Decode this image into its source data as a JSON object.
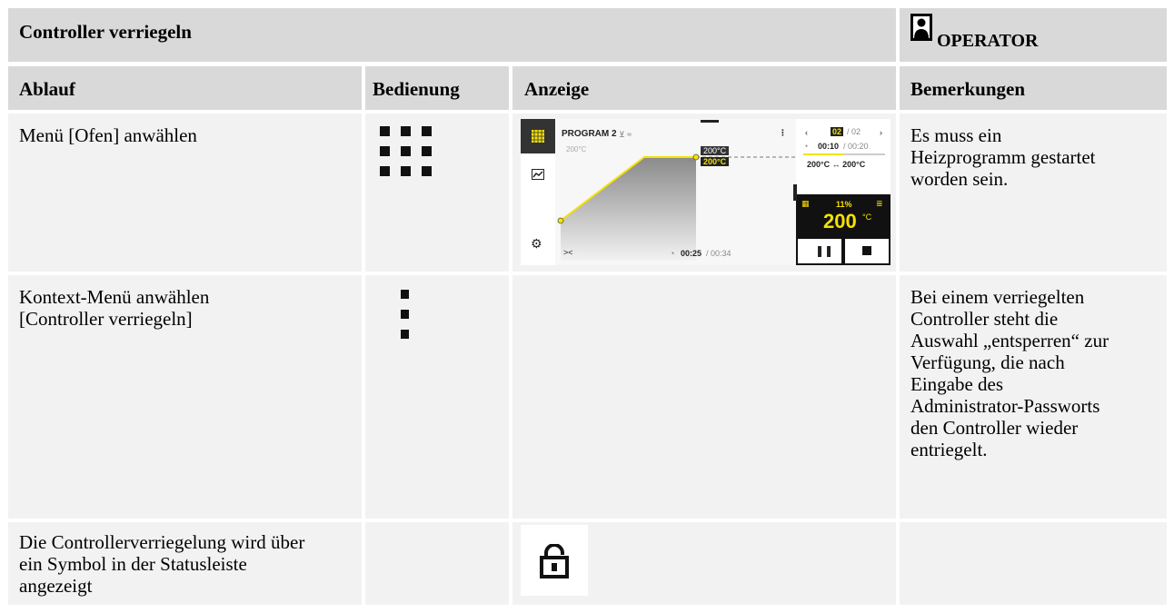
{
  "header": {
    "title": "Controller verriegeln",
    "role": "OPERATOR",
    "role_icon": "person-icon"
  },
  "columns": [
    "Ablauf",
    "Bedienung",
    "Anzeige",
    "Bemerkungen"
  ],
  "rows": [
    {
      "ablauf": "Menü [Ofen] anwählen",
      "bedienung_icon": "grid-menu-icon",
      "bemerkungen": "Es muss ein Heizprogramm gestartet worden sein."
    },
    {
      "ablauf": "Kontext-Menü anwählen [Controller verriegeln]",
      "bedienung_icon": "kebab-menu-icon",
      "bemerkungen": "Bei einem verriegelten Controller steht die Auswahl „entsperren“ zur Verfügung, die nach Eingabe des Administrator-Passworts den Controller wieder entriegelt."
    },
    {
      "ablauf": "Die Controllerverriegelung wird über ein Symbol in der Statusleiste angezeigt",
      "anzeige_icon": "padlock-icon"
    }
  ],
  "screen": {
    "program": "PROGRAM 2",
    "axis_label": "200°C",
    "tag_top": "200°C",
    "tag_bottom": "200°C",
    "segment_current": "02",
    "segment_total": "/ 02",
    "time_segment": "00:10",
    "time_segment_total": "/ 00:20",
    "temp_range": "200°C ↔ 200°C",
    "power": "11%",
    "temp_value": "200",
    "temp_unit": "°C",
    "time_total": "00:25",
    "time_total_max": "/ 00:34",
    "accent": "#f5e100"
  }
}
